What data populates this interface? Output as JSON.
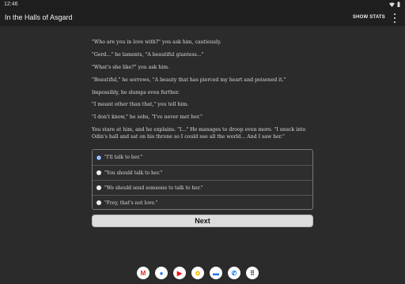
{
  "status_bar": {
    "time": "12:46"
  },
  "app_bar": {
    "title": "In the Halls of Asgard",
    "show_stats": "SHOW STATS"
  },
  "story": {
    "paragraphs": [
      "\"Who are you in love with?\" you ask him, cautiously.",
      "\"Gerd...\" he laments, \"A beautiful giantess...\"",
      "\"What's she like?\" you ask him.",
      "\"Beautiful,\" he sorrows, \"A beauty that has pierced my heart and poisoned it.\"",
      "Impossibly, he slumps even further.",
      "\"I meant other than that,\" you tell him.",
      "\"I don't know,\" he sobs, \"I've never met her.\"",
      "You stare at him, and he explains. \"I...\" He manages to droop even more. \"I snuck into Odin's hall and sat on his throne so I could see all the world... And I saw her.\""
    ]
  },
  "choices": [
    {
      "label": "\"I'll talk to her.\"",
      "selected": true
    },
    {
      "label": "\"You should talk to her.\"",
      "selected": false
    },
    {
      "label": "\"We should send someone to talk to her.\"",
      "selected": false
    },
    {
      "label": "\"Frey, that's not love.\"",
      "selected": false
    }
  ],
  "next_label": "Next",
  "taskbar": {
    "apps": [
      {
        "name": "gmail-icon",
        "glyph": "M",
        "color": "#d93025"
      },
      {
        "name": "chrome-icon",
        "glyph": "●",
        "color": "#1a73e8"
      },
      {
        "name": "youtube-icon",
        "glyph": "▶",
        "color": "#ff0000"
      },
      {
        "name": "photos-icon",
        "glyph": "✿",
        "color": "#fbbc04"
      },
      {
        "name": "messages-icon",
        "glyph": "▬",
        "color": "#1a73e8"
      },
      {
        "name": "phone-icon",
        "glyph": "✆",
        "color": "#1a73e8"
      },
      {
        "name": "app-drawer-icon",
        "glyph": "⠿",
        "color": "#333333"
      }
    ]
  }
}
